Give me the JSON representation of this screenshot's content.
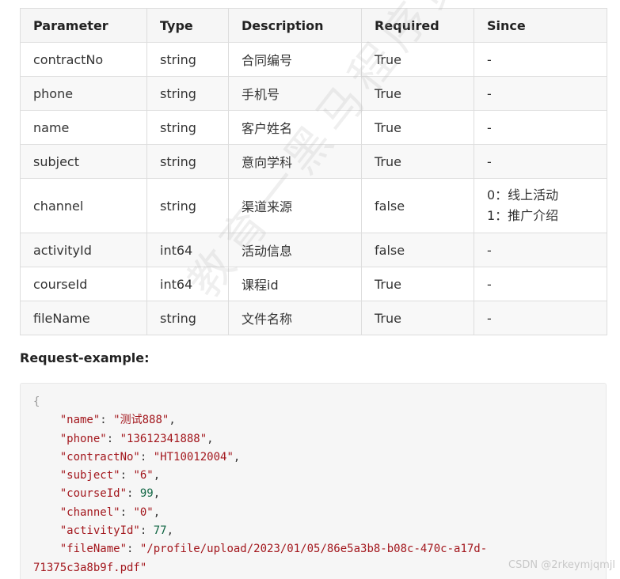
{
  "table": {
    "headers": [
      "Parameter",
      "Type",
      "Description",
      "Required",
      "Since"
    ],
    "rows": [
      {
        "parameter": "contractNo",
        "type": "string",
        "description": "合同编号",
        "required": "True",
        "since": "-"
      },
      {
        "parameter": "phone",
        "type": "string",
        "description": "手机号",
        "required": "True",
        "since": "-"
      },
      {
        "parameter": "name",
        "type": "string",
        "description": "客户姓名",
        "required": "True",
        "since": "-"
      },
      {
        "parameter": "subject",
        "type": "string",
        "description": "意向学科",
        "required": "True",
        "since": "-"
      },
      {
        "parameter": "channel",
        "type": "string",
        "description": "渠道来源",
        "required": "false",
        "since_lines": [
          "0：线上活动",
          "1：推广介绍"
        ]
      },
      {
        "parameter": "activityId",
        "type": "int64",
        "description": "活动信息",
        "required": "false",
        "since": "-"
      },
      {
        "parameter": "courseId",
        "type": "int64",
        "description": "课程id",
        "required": "True",
        "since": "-"
      },
      {
        "parameter": "fileName",
        "type": "string",
        "description": "文件名称",
        "required": "True",
        "since": "-"
      }
    ]
  },
  "request_example": {
    "title": "Request-example:",
    "open_brace": "{",
    "fields": [
      {
        "key": "\"name\"",
        "value": "\"测试888\"",
        "value_kind": "str"
      },
      {
        "key": "\"phone\"",
        "value": "\"13612341888\"",
        "value_kind": "str"
      },
      {
        "key": "\"contractNo\"",
        "value": "\"HT10012004\"",
        "value_kind": "str"
      },
      {
        "key": "\"subject\"",
        "value": "\"6\"",
        "value_kind": "str"
      },
      {
        "key": "\"courseId\"",
        "value": "99",
        "value_kind": "num"
      },
      {
        "key": "\"channel\"",
        "value": "\"0\"",
        "value_kind": "str"
      },
      {
        "key": "\"activityId\"",
        "value": "77",
        "value_kind": "num"
      },
      {
        "key": "\"fileName\"",
        "value": "\"/profile/upload/2023/01/05/86e5a3b8-b08c-470c-a17d-",
        "value_kind": "str"
      }
    ],
    "wrapped_line": "71375c3a8b9f.pdf\""
  },
  "watermark": "教育一黑马程序员",
  "credit": "CSDN @2rkeymjqmjl"
}
